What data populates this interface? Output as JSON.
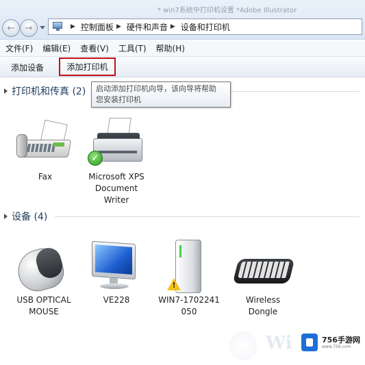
{
  "window": {
    "ghost_title": "*  win7系统中打印机设置 *Adobe Illustrator"
  },
  "address_bar": {
    "icon": "control-panel-icon",
    "breadcrumbs": [
      "控制面板",
      "硬件和声音",
      "设备和打印机"
    ]
  },
  "menu": {
    "items": [
      "文件(F)",
      "编辑(E)",
      "查看(V)",
      "工具(T)",
      "帮助(H)"
    ]
  },
  "command_bar": {
    "add_device": "添加设备",
    "add_printer": "添加打印机",
    "highlight_color": "#c0101a"
  },
  "tooltip": {
    "line1": "启动添加打印机向导，该向导将帮助",
    "line2": "您安装打印机"
  },
  "groups": {
    "printers": {
      "title": "打印机和传真 (2)",
      "items": [
        {
          "label_lines": [
            "Fax"
          ],
          "icon": "fax-icon"
        },
        {
          "label_lines": [
            "Microsoft XPS",
            "Document",
            "Writer"
          ],
          "icon": "printer-icon",
          "status_icon": "default-check-icon"
        }
      ]
    },
    "devices": {
      "title": "设备 (4)",
      "items": [
        {
          "label_lines": [
            "USB OPTICAL",
            "MOUSE"
          ],
          "icon": "mouse-icon"
        },
        {
          "label_lines": [
            "VE228"
          ],
          "icon": "monitor-icon"
        },
        {
          "label_lines": [
            "WIN7-1702241",
            "050"
          ],
          "icon": "computer-tower-icon",
          "status_icon": "warning-icon"
        },
        {
          "label_lines": [
            "Wireless",
            "Dongle"
          ],
          "icon": "keyboard-icon"
        }
      ]
    }
  },
  "watermark": {
    "brand_name": "756手游网",
    "brand_url": "www.756.com"
  }
}
